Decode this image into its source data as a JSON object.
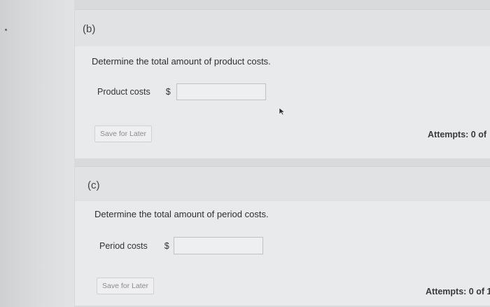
{
  "parts": [
    {
      "label": "(b)",
      "question": "Determine the total amount of product costs.",
      "field_label": "Product costs",
      "currency": "$",
      "value": "",
      "save_label": "Save for Later",
      "attempts": "Attempts: 0 of"
    },
    {
      "label": "(c)",
      "question": "Determine the total amount of period costs.",
      "field_label": "Period costs",
      "currency": "$",
      "value": "",
      "save_label": "Save for Later",
      "attempts": "Attempts: 0 of 1"
    }
  ],
  "icons": {
    "cursor": "mouse-pointer-icon"
  }
}
